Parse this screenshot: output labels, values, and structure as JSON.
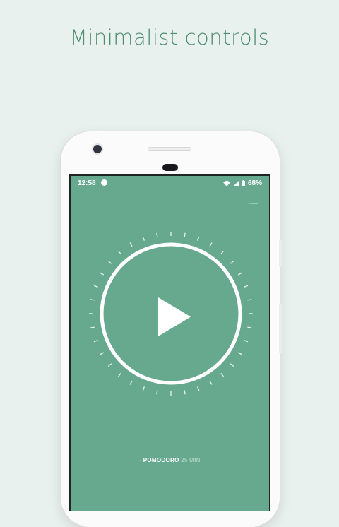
{
  "headline": "Minimalist controls",
  "status_bar": {
    "time": "12:58",
    "battery": "68%",
    "icons": [
      "notification-dot-icon",
      "wifi-icon",
      "cellular-icon",
      "battery-icon"
    ]
  },
  "toolbar": {
    "icons": [
      "list-icon"
    ]
  },
  "timer": {
    "control": "play-icon",
    "ring_color": "#ffffff",
    "dots_left": "· · · ·",
    "dots_right": "· · · ·"
  },
  "session": {
    "prefix": "-",
    "mode": "POMODORO",
    "duration": "25 MIN"
  },
  "colors": {
    "background": "#e9f1ee",
    "accent": "#67a98f",
    "headline": "#4d8b72"
  }
}
